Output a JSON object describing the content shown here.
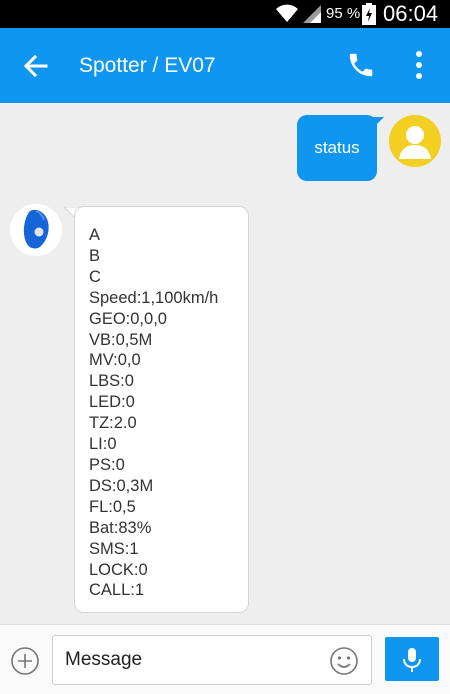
{
  "status_bar": {
    "battery_percent": "95 %",
    "time": "06:04"
  },
  "app_bar": {
    "title": "Spotter / EV07"
  },
  "colors": {
    "accent": "#0f96f0",
    "avatar_yellow": "#f2cf21",
    "device_blue": "#1565d8"
  },
  "messages": {
    "outgoing": {
      "text": "status"
    },
    "incoming": {
      "lines": [
        "A",
        "B",
        "C",
        "Speed:1,100km/h",
        "GEO:0,0,0",
        "VB:0,5M",
        "MV:0,0",
        "LBS:0",
        "LED:0",
        "TZ:2.0",
        "LI:0",
        "PS:0",
        "DS:0,3M",
        "FL:0,5",
        "Bat:83%",
        "SMS:1",
        "LOCK:0",
        "CALL:1"
      ]
    }
  },
  "composer": {
    "placeholder": "Message"
  },
  "icons": [
    "wifi-icon",
    "signal-icon",
    "battery-icon",
    "back-arrow-icon",
    "phone-icon",
    "more-vert-icon",
    "user-avatar-icon",
    "device-avatar-icon",
    "add-circle-icon",
    "emoji-icon",
    "mic-icon"
  ]
}
